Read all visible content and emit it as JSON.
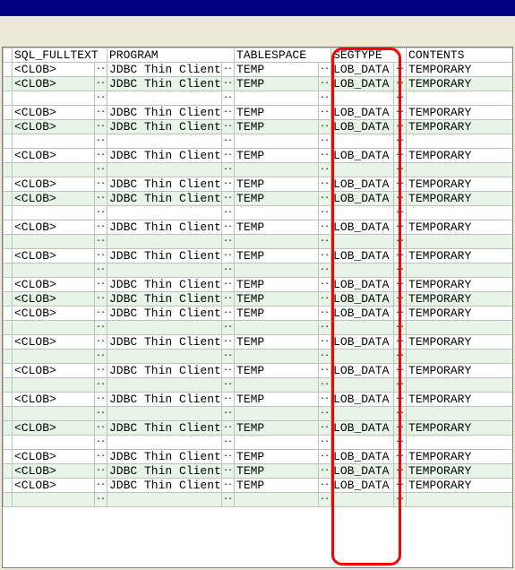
{
  "headers": {
    "sql_fulltext": "SQL_FULLTEXT",
    "program": "PROGRAM",
    "tablespace": "TABLESPACE",
    "segtype": "SEGTYPE",
    "contents": "CONTENTS"
  },
  "cell": {
    "clob": "<CLOB>",
    "jdbc": "JDBC Thin Client",
    "temp": "TEMP",
    "lob": "LOB_DATA",
    "temporary": "TEMPORARY",
    "dots": "···"
  },
  "rows": [
    {
      "blank": false,
      "alt": false
    },
    {
      "blank": false,
      "alt": true
    },
    {
      "blank": true,
      "alt": false
    },
    {
      "blank": false,
      "alt": false
    },
    {
      "blank": false,
      "alt": true
    },
    {
      "blank": true,
      "alt": false
    },
    {
      "blank": false,
      "alt": false
    },
    {
      "blank": true,
      "alt": true
    },
    {
      "blank": false,
      "alt": false
    },
    {
      "blank": false,
      "alt": true
    },
    {
      "blank": true,
      "alt": false
    },
    {
      "blank": false,
      "alt": false
    },
    {
      "blank": true,
      "alt": true
    },
    {
      "blank": false,
      "alt": false
    },
    {
      "blank": true,
      "alt": true
    },
    {
      "blank": false,
      "alt": false
    },
    {
      "blank": false,
      "alt": true
    },
    {
      "blank": false,
      "alt": false
    },
    {
      "blank": true,
      "alt": true
    },
    {
      "blank": false,
      "alt": false
    },
    {
      "blank": true,
      "alt": true
    },
    {
      "blank": false,
      "alt": false
    },
    {
      "blank": true,
      "alt": true
    },
    {
      "blank": false,
      "alt": false
    },
    {
      "blank": true,
      "alt": true
    },
    {
      "blank": false,
      "alt": true
    },
    {
      "blank": true,
      "alt": false
    },
    {
      "blank": false,
      "alt": false
    },
    {
      "blank": false,
      "alt": true
    },
    {
      "blank": false,
      "alt": false
    },
    {
      "blank": true,
      "alt": true
    }
  ]
}
